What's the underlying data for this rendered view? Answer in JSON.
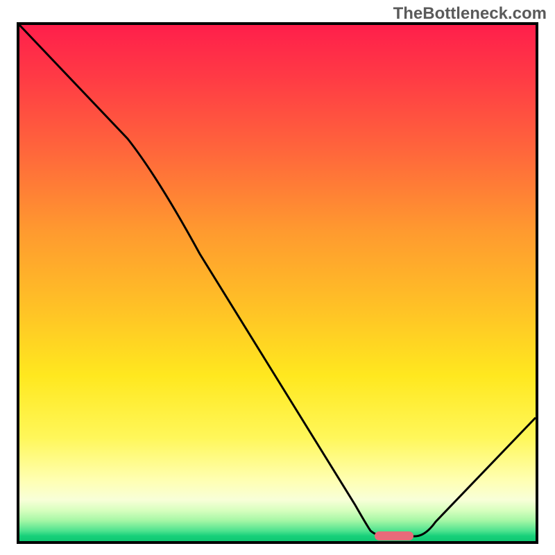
{
  "watermark": "TheBottleneck.com",
  "chart_data": {
    "type": "line",
    "title": "",
    "xlabel": "",
    "ylabel": "",
    "xlim": [
      0,
      100
    ],
    "ylim": [
      0,
      100
    ],
    "series": [
      {
        "name": "bottleneck-curve",
        "x": [
          0,
          21,
          65,
          68,
          72,
          77,
          100
        ],
        "y": [
          100,
          78,
          7,
          2,
          1,
          2,
          26
        ],
        "color": "#000000"
      }
    ],
    "marker": {
      "name": "optimal-segment",
      "x_start": 69,
      "x_end": 76,
      "y": 1,
      "color": "#e86a7a"
    },
    "gradient_stops": [
      {
        "pos": 0.0,
        "color": "#ff1f4b"
      },
      {
        "pos": 0.1,
        "color": "#ff3a45"
      },
      {
        "pos": 0.25,
        "color": "#ff683b"
      },
      {
        "pos": 0.4,
        "color": "#ff9a2f"
      },
      {
        "pos": 0.55,
        "color": "#ffc226"
      },
      {
        "pos": 0.68,
        "color": "#ffe81f"
      },
      {
        "pos": 0.8,
        "color": "#fff75a"
      },
      {
        "pos": 0.88,
        "color": "#ffffb0"
      },
      {
        "pos": 0.92,
        "color": "#f8ffd8"
      },
      {
        "pos": 0.94,
        "color": "#d8ffbf"
      },
      {
        "pos": 0.96,
        "color": "#a6f7a6"
      },
      {
        "pos": 0.98,
        "color": "#4fe38f"
      },
      {
        "pos": 0.99,
        "color": "#17d07a"
      },
      {
        "pos": 1.0,
        "color": "#0fc973"
      }
    ]
  }
}
